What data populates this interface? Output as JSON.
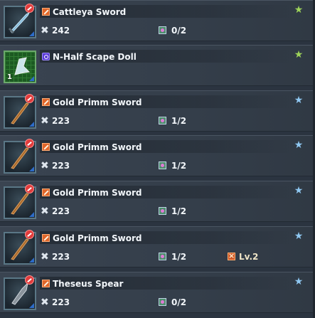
{
  "items": [
    {
      "name": "Cattleya Sword",
      "attack": "242",
      "slots": "0/2",
      "augment": "",
      "star": "green",
      "thumb": "cattleya",
      "kind": "weapon",
      "quantity": ""
    },
    {
      "name": "N-Half Scape Doll",
      "attack": "",
      "slots": "",
      "augment": "",
      "star": "green",
      "thumb": "doll",
      "kind": "doll",
      "quantity": "1"
    },
    {
      "name": "Gold Primm Sword",
      "attack": "223",
      "slots": "1/2",
      "augment": "",
      "star": "blue",
      "thumb": "primm",
      "kind": "weapon",
      "quantity": ""
    },
    {
      "name": "Gold Primm Sword",
      "attack": "223",
      "slots": "1/2",
      "augment": "",
      "star": "blue",
      "thumb": "primm",
      "kind": "weapon",
      "quantity": ""
    },
    {
      "name": "Gold Primm Sword",
      "attack": "223",
      "slots": "1/2",
      "augment": "",
      "star": "blue",
      "thumb": "primm",
      "kind": "weapon",
      "quantity": ""
    },
    {
      "name": "Gold Primm Sword",
      "attack": "223",
      "slots": "1/2",
      "augment": "Lv.2",
      "star": "blue",
      "thumb": "primm",
      "kind": "weapon",
      "quantity": ""
    },
    {
      "name": "Theseus Spear",
      "attack": "223",
      "slots": "0/2",
      "augment": "",
      "star": "blue",
      "thumb": "spear",
      "kind": "weapon",
      "quantity": ""
    }
  ],
  "colors": {
    "star_green": "#9ed45a",
    "star_blue": "#8fc8f2",
    "type_weapon": "#e0662a",
    "type_doll": "#5a3bd6",
    "no_badge": "#e23c3c"
  }
}
